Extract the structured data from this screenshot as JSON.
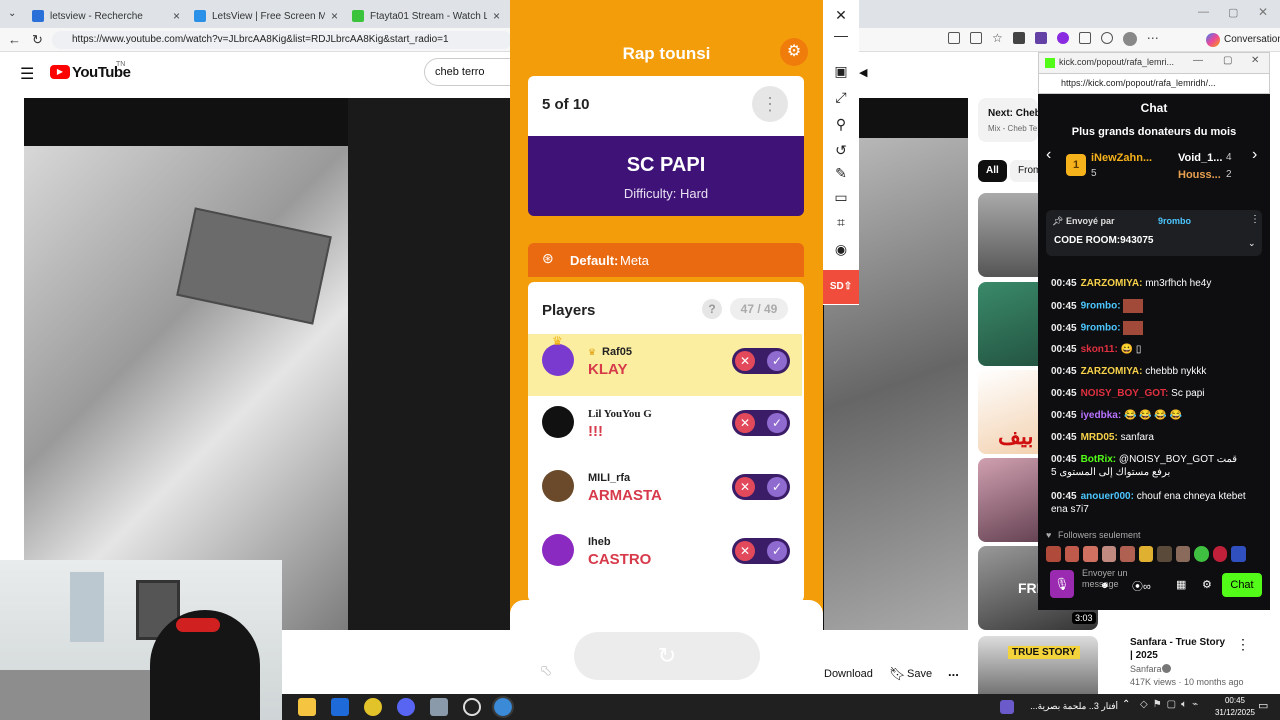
{
  "browser": {
    "tabs": [
      {
        "label": "letsview - Recherche",
        "color": "#2b6fd8"
      },
      {
        "label": "LetsView | Free Screen Mirroring A",
        "color": "#2b90e8"
      },
      {
        "label": "Ftayta01 Stream - Watch Live on K",
        "color": "#3bc43b"
      }
    ],
    "url": "https://www.youtube.com/watch?v=JLbrcAA8Kig&list=RDJLbrcAA8Kig&start_radio=1",
    "conversation_label": "Conversation"
  },
  "youtube": {
    "logo": "YouTube",
    "region": "TN",
    "search_value": "cheb terro",
    "next_label": "Next: Cheb T",
    "mix_label": "Mix - Cheb Te",
    "chips": [
      "All",
      "From"
    ],
    "download_label": "Download",
    "save_label": "Save",
    "more_label": "...",
    "sidebar_video": {
      "title": "Sanfara - True Story | 2025",
      "channel": "Sanfara",
      "meta": "417K views · 10 months ago",
      "duration": "3:03",
      "thumb_text": "FRE",
      "true_story": "TRUE STORY"
    },
    "arabic_badge": "بيف"
  },
  "game": {
    "title": "Rap tounsi",
    "round": "5 of 10",
    "word": "SC PAPI",
    "difficulty": "Difficulty: Hard",
    "default_label": "Default:",
    "default_value": "Meta",
    "players_title": "Players",
    "help": "?",
    "players_count": "47 / 49",
    "players": [
      {
        "name": "Raf05",
        "word": "KLAY",
        "highlight": true,
        "avatar_color": "#7a3ad0"
      },
      {
        "name": "Lil YouYou G",
        "word": "!!!",
        "highlight": false,
        "avatar_color": "#111111"
      },
      {
        "name": "MILI_rfa",
        "word": "ARMASTA",
        "highlight": false,
        "avatar_color": "#6a4a2a"
      },
      {
        "name": "Iheb",
        "word": "CASTRO",
        "highlight": false,
        "avatar_color": "#8a2ac0"
      }
    ]
  },
  "toolbar": {
    "close": "✕",
    "minimize": "—",
    "sd": "SD"
  },
  "kick": {
    "window_url_short": "kick.com/popout/rafa_lemri...",
    "window_url": "https://kick.com/popout/rafa_lemridh/...",
    "chat_title": "Chat",
    "donors_title": "Plus grands donateurs du mois",
    "donors": [
      {
        "rank": "1",
        "name": "iNewZahn...",
        "amount": "5"
      },
      {
        "name": "Void_1...",
        "amount": "4"
      },
      {
        "name": "Houss...",
        "amount": "2"
      }
    ],
    "pinned_by": "Envoyé par",
    "pinned_user": "9rombo",
    "pinned_msg": "CODE ROOM:943075",
    "messages": [
      {
        "time": "00:45",
        "user": "ZARZOMIYA:",
        "text": "mn3rfhch he4y",
        "color": "#f7d24a"
      },
      {
        "time": "00:45",
        "user": "9rombo:",
        "text": "",
        "color": "#4cc6ff"
      },
      {
        "time": "00:45",
        "user": "9rombo:",
        "text": "",
        "color": "#4cc6ff"
      },
      {
        "time": "00:45",
        "user": "skon11:",
        "text": "😀 ▯",
        "color": "#e03040"
      },
      {
        "time": "00:45",
        "user": "ZARZOMIYA:",
        "text": "chebbb nykkk",
        "color": "#f7d24a"
      },
      {
        "time": "00:45",
        "user": "NOISY_BOY_GOT:",
        "text": "Sc papi",
        "color": "#e03040"
      },
      {
        "time": "00:45",
        "user": "iyedbka:",
        "text": "😂 😂 😂 😂",
        "color": "#b873ff"
      },
      {
        "time": "00:45",
        "user": "MRD05:",
        "text": "sanfara",
        "color": "#f7d24a"
      },
      {
        "time": "00:45",
        "user": "BotRix:",
        "text": "@NOISY_BOY_GOT قمت برفع مستواك إلى المستوى 5",
        "color": "#53fc18"
      },
      {
        "time": "00:45",
        "user": "anouer000:",
        "text": "chouf ena chneya ktebet ena s7i7",
        "color": "#4cc6ff"
      }
    ],
    "followers_only": "Followers seulement",
    "send_placeholder": "Envoyer un message",
    "chat_button": "Chat"
  },
  "taskbar": {
    "news": "أفتار 3.. ملحمة بصرية...",
    "time": "00:45",
    "date": "31/12/2025"
  }
}
